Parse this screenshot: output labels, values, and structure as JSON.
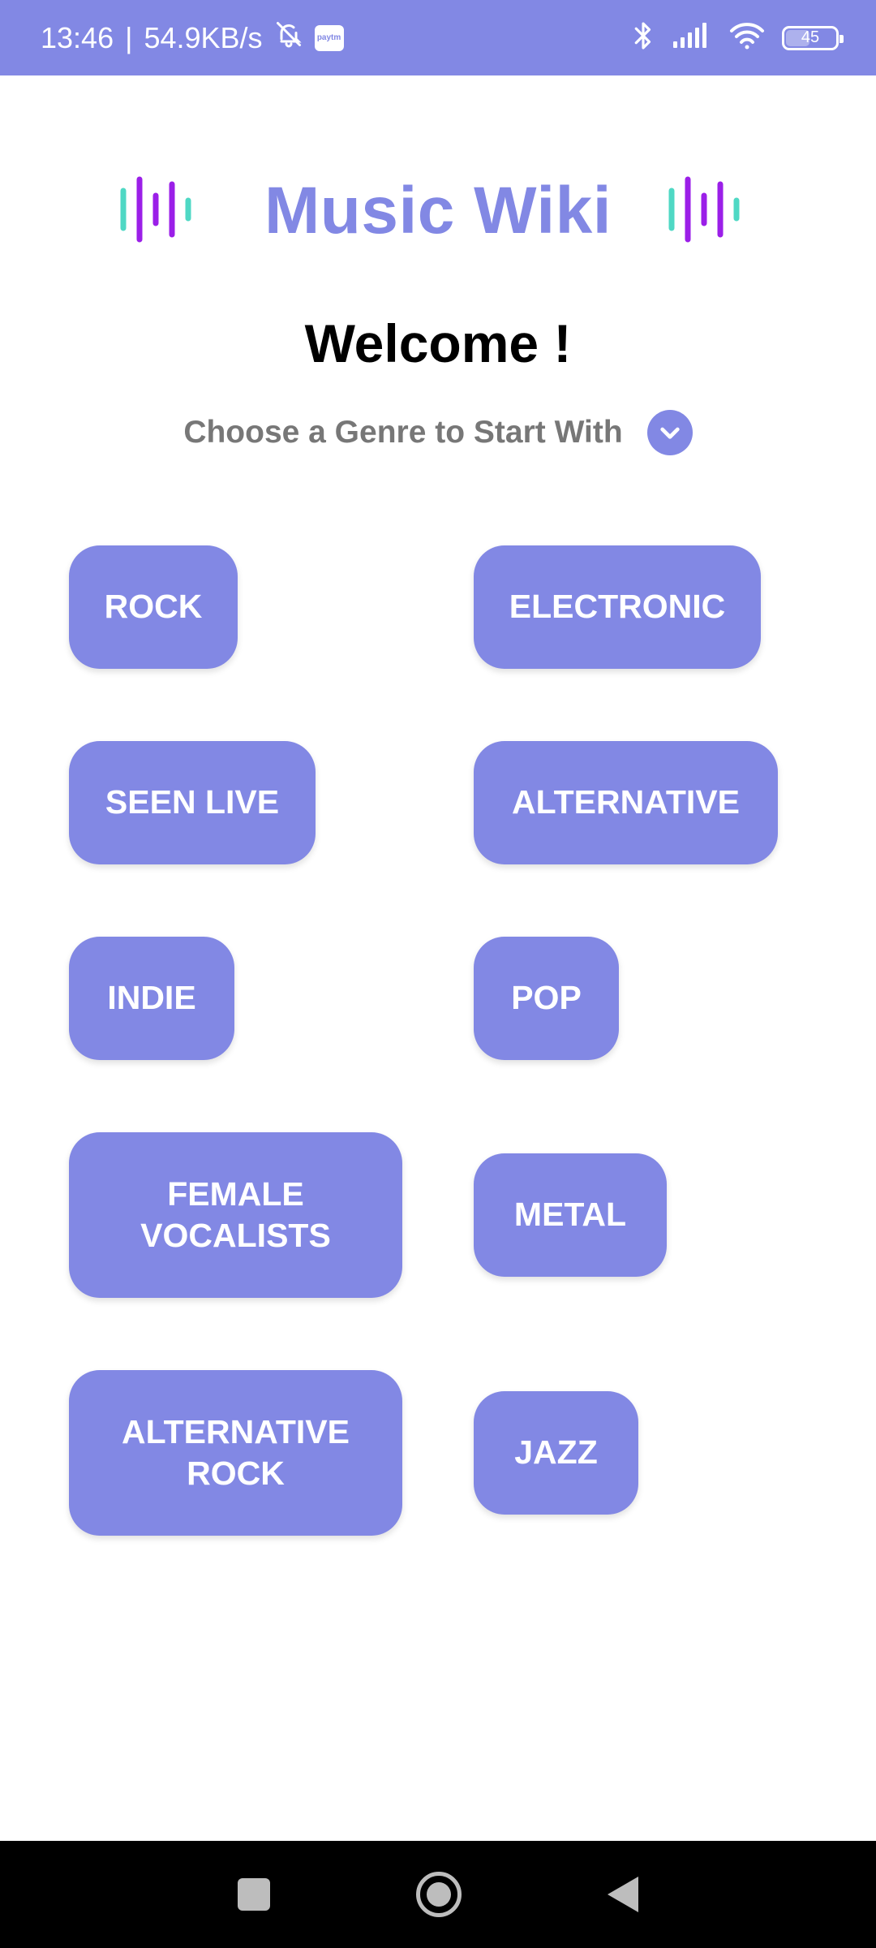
{
  "status_bar": {
    "time": "13:46",
    "separator": "|",
    "net_speed": "54.9KB/s",
    "paytm_label": "paytm",
    "battery_level": "45"
  },
  "header": {
    "title": "Music Wiki"
  },
  "welcome": {
    "heading": "Welcome !",
    "subtitle": "Choose a Genre to Start With"
  },
  "genres": [
    {
      "label": "ROCK"
    },
    {
      "label": "ELECTRONIC"
    },
    {
      "label": "SEEN LIVE"
    },
    {
      "label": "ALTERNATIVE"
    },
    {
      "label": "INDIE"
    },
    {
      "label": "POP"
    },
    {
      "label": "FEMALE VOCALISTS"
    },
    {
      "label": "METAL"
    },
    {
      "label": "ALTERNATIVE ROCK"
    },
    {
      "label": "JAZZ"
    }
  ],
  "colors": {
    "accent": "#8288e4",
    "wave_teal": "#4fd8c4",
    "wave_purple": "#9b1fe8"
  }
}
